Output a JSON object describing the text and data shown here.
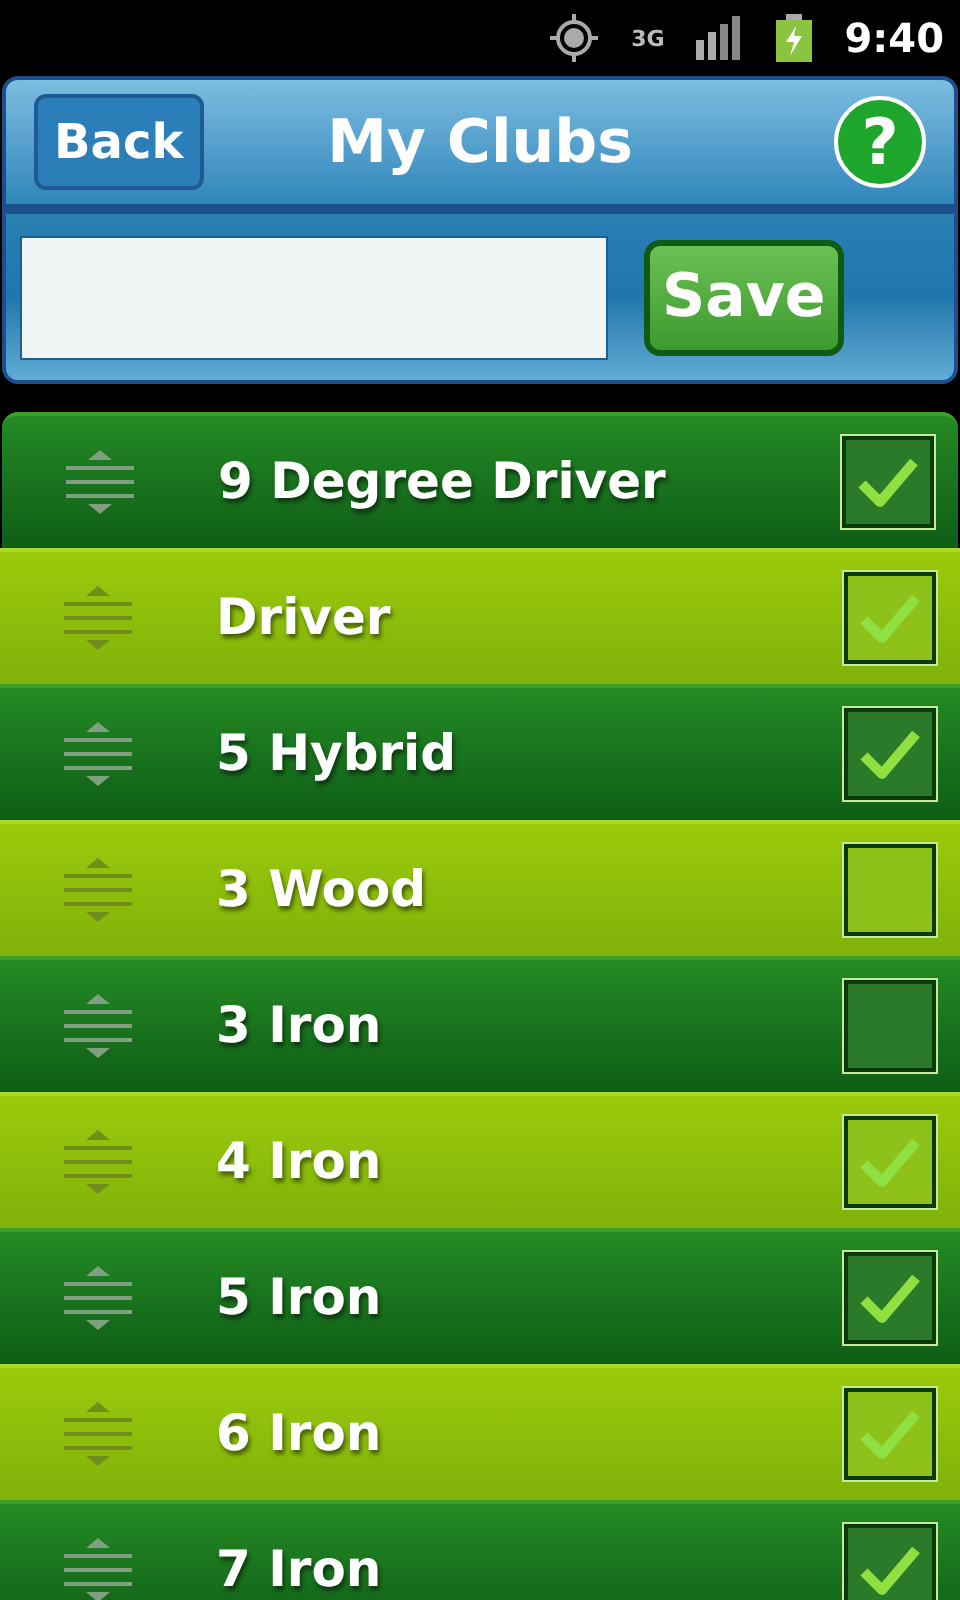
{
  "status_bar": {
    "time": "9:40",
    "network": "3G"
  },
  "header": {
    "back": "Back",
    "title": "My Clubs",
    "help": "?"
  },
  "form": {
    "save": "Save"
  },
  "clubs": [
    {
      "name": "9 Degree Driver",
      "checked": true
    },
    {
      "name": "Driver",
      "checked": true
    },
    {
      "name": "5 Hybrid",
      "checked": true
    },
    {
      "name": "3 Wood",
      "checked": false
    },
    {
      "name": "3 Iron",
      "checked": false
    },
    {
      "name": "4 Iron",
      "checked": true
    },
    {
      "name": "5 Iron",
      "checked": true
    },
    {
      "name": "6 Iron",
      "checked": true
    },
    {
      "name": "7 Iron",
      "checked": true
    }
  ]
}
